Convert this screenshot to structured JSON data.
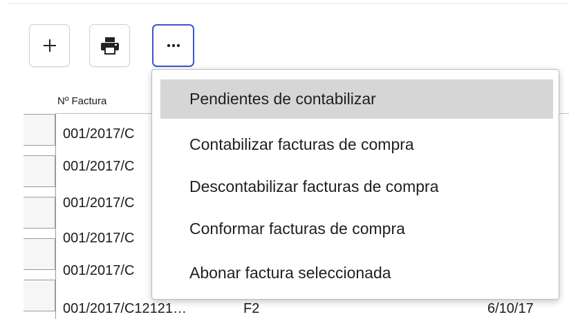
{
  "toolbar": {
    "buttons": [
      {
        "name": "add",
        "icon": "plus-icon",
        "glyph": "+"
      },
      {
        "name": "print",
        "icon": "printer-icon"
      },
      {
        "name": "more",
        "icon": "ellipsis-icon",
        "glyph": "•••"
      }
    ],
    "focus_color": "#3a56cf"
  },
  "table": {
    "column_header": "Nº Factura",
    "rows": [
      "001/2017/C",
      "001/2017/C",
      "001/2017/C",
      "001/2017/C",
      "001/2017/C"
    ],
    "last_row": {
      "number": "001/2017/C12121…",
      "type": "F2",
      "date": "6/10/17"
    }
  },
  "menu": {
    "items": [
      {
        "label": "Pendientes de contabilizar",
        "highlighted": true
      },
      {
        "label": "Contabilizar facturas de compra",
        "highlighted": false
      },
      {
        "label": "Descontabilizar facturas de compra",
        "highlighted": false
      },
      {
        "label": "Conformar facturas de compra",
        "highlighted": false
      },
      {
        "label": "Abonar factura seleccionada",
        "highlighted": false
      }
    ],
    "highlight_color": "#d6d6d6"
  }
}
